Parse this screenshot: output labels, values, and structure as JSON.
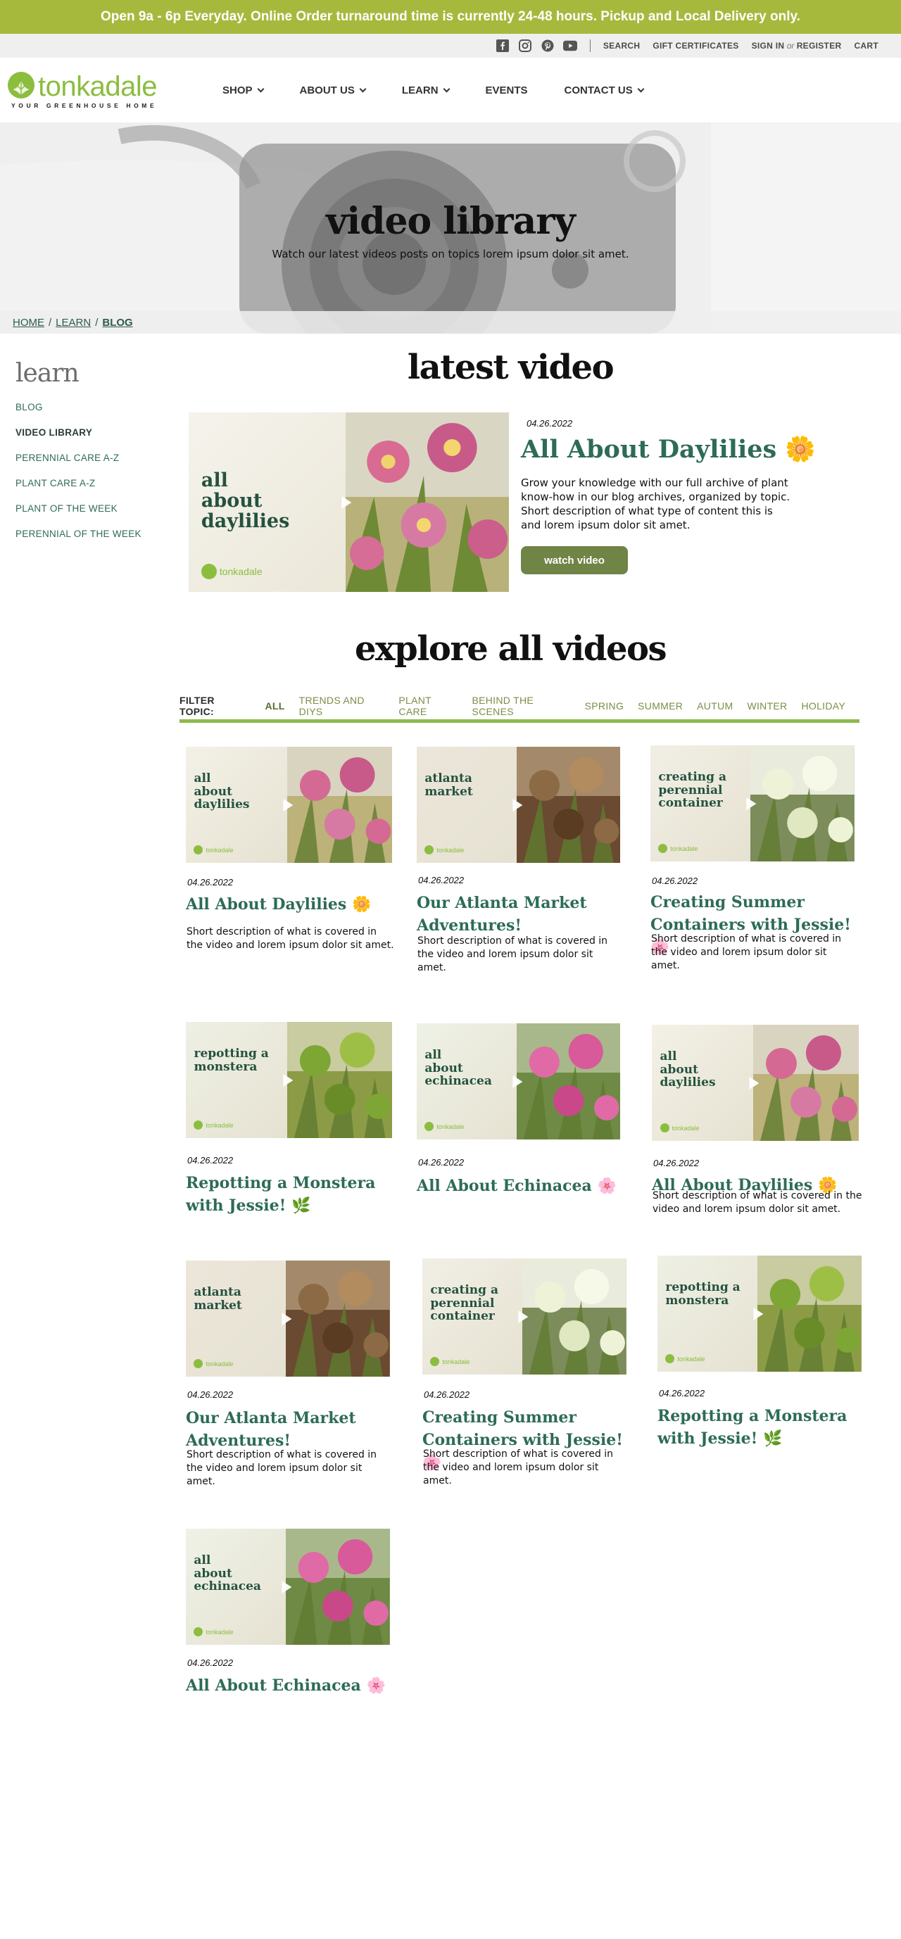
{
  "announcement": "Open 9a - 6p Everyday. Online Order turnaround time is currently 24-48 hours.  Pickup and Local Delivery only.",
  "utility": {
    "social_icons": [
      "facebook-icon",
      "instagram-icon",
      "pinterest-icon",
      "youtube-icon"
    ],
    "search": "SEARCH",
    "gift": "GIFT CERTIFICATES",
    "sign_in": "SIGN IN",
    "or": "or",
    "register": "REGISTER",
    "cart": "CART"
  },
  "logo": {
    "word": "tonkadale",
    "tagline": "YOUR GREENHOUSE HOME"
  },
  "nav": [
    {
      "label": "SHOP",
      "dropdown": true
    },
    {
      "label": "ABOUT US",
      "dropdown": true
    },
    {
      "label": "LEARN",
      "dropdown": true
    },
    {
      "label": "EVENTS",
      "dropdown": false
    },
    {
      "label": "CONTACT US",
      "dropdown": true
    }
  ],
  "hero": {
    "title": "video library",
    "subtitle": "Watch our latest videos posts on topics lorem ipsum dolor sit amet."
  },
  "breadcrumb": {
    "home": "HOME",
    "sep1": "/",
    "learn": "LEARN",
    "sep2": "/",
    "blog": "BLOG"
  },
  "sidebar": {
    "title": "learn",
    "items": [
      "BLOG",
      "VIDEO LIBRARY",
      "PERENNIAL CARE A-Z",
      "PLANT CARE A-Z",
      "PLANT OF THE WEEK",
      "PERENNIAL OF THE WEEK"
    ],
    "active": "VIDEO LIBRARY"
  },
  "latest": {
    "heading": "latest video",
    "date": "04.26.2022",
    "title": "All About Daylilies",
    "emoji": "🌼",
    "thumb_text": "all\nabout\ndaylilies",
    "description": "Grow your knowledge with our full archive of plant know-how in our blog archives, organized by topic. Short description of what type of content this is and lorem ipsum dolor sit amet.",
    "button": "watch video",
    "brand": "tonkadale"
  },
  "explore": {
    "heading": "explore all videos",
    "filter_label": "FILTER TOPIC:",
    "filters": [
      "ALL",
      "TRENDS AND DIYS",
      "PLANT CARE",
      "BEHIND THE SCENES",
      "SPRING",
      "SUMMER",
      "AUTUM",
      "WINTER",
      "HOLIDAY"
    ],
    "active_filter": "ALL"
  },
  "videos": [
    {
      "thumb_text": "all\nabout\ndaylilies",
      "date": "04.26.2022",
      "title": "All About Daylilies",
      "emoji": "🌼",
      "description": "Short description of what is covered in the video and lorem ipsum dolor sit amet.",
      "brand": "tonkadale"
    },
    {
      "thumb_text": "atlanta\nmarket",
      "date": "04.26.2022",
      "title": "Our Atlanta Market Adventures!",
      "emoji": "",
      "description": "Short description of what is covered in the video and lorem ipsum dolor sit amet.",
      "brand": "tonkadale"
    },
    {
      "thumb_text": "creating a\nperennial\ncontainer",
      "date": "04.26.2022",
      "title": "Creating Summer Containers with Jessie!",
      "emoji": "🌸",
      "description": "Short description of what is covered in the video and lorem ipsum dolor sit amet.",
      "brand": "tonkadale"
    },
    {
      "thumb_text": "repotting a\nmonstera",
      "date": "04.26.2022",
      "title": "Repotting a Monstera with Jessie!",
      "emoji": "🌿",
      "description": "",
      "brand": "tonkadale"
    },
    {
      "thumb_text": "all\nabout\nechinacea",
      "date": "04.26.2022",
      "title": "All About Echinacea",
      "emoji": "🌸",
      "description": "",
      "brand": "tonkadale"
    },
    {
      "thumb_text": "all\nabout\ndaylilies",
      "date": "04.26.2022",
      "title": "All About Daylilies",
      "emoji": "🌼",
      "description": "Short description of what is covered in the video and lorem ipsum dolor sit amet.",
      "brand": "tonkadale"
    },
    {
      "thumb_text": "atlanta\nmarket",
      "date": "04.26.2022",
      "title": "Our Atlanta Market Adventures!",
      "emoji": "",
      "description": "Short description of what is covered in the video and lorem ipsum dolor sit amet.",
      "brand": "tonkadale"
    },
    {
      "thumb_text": "creating a\nperennial\ncontainer",
      "date": "04.26.2022",
      "title": "Creating Summer Containers with Jessie!",
      "emoji": "🌸",
      "description": "Short description of what is covered in the video and lorem ipsum dolor sit amet.",
      "brand": "tonkadale"
    },
    {
      "thumb_text": "repotting a\nmonstera",
      "date": "04.26.2022",
      "title": "Repotting a Monstera with Jessie!",
      "emoji": "🌿",
      "description": "",
      "brand": "tonkadale"
    },
    {
      "thumb_text": "all\nabout\nechinacea",
      "date": "04.26.2022",
      "title": "All About Echinacea",
      "emoji": "🌸",
      "description": "",
      "brand": "tonkadale"
    }
  ],
  "colors": {
    "announce_bg": "#a7b93d",
    "brand_green": "#8bbd3f",
    "title_green": "#2d6b58",
    "button_green": "#6f8445",
    "filter_line": "#8fb94c"
  }
}
